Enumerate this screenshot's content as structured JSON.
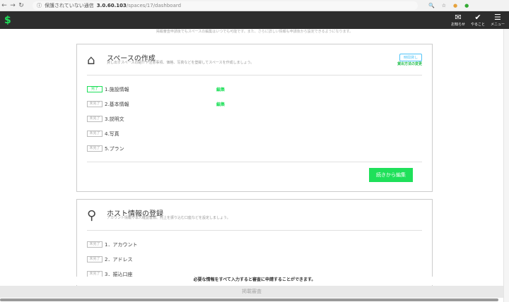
{
  "browser": {
    "insecure": "保護されていない通信",
    "host": "3.0.60.103",
    "path": "/spaces/17/dashboard"
  },
  "header": {
    "logo": "$",
    "buttons": [
      {
        "icon": "✉",
        "label": "お知らせ"
      },
      {
        "icon": "✔",
        "label": "やること"
      },
      {
        "icon": "☰",
        "label": "メニュー"
      }
    ]
  },
  "notice": "掲載審査申請後でもスペースの編集はいつでも可能です。また、さらに詳しい情報も申請後から設定できるようになります。",
  "space": {
    "title": "スペースの作成",
    "desc": "貸し出すスペースの紹介や注意事項、価格、写真などを登録してスペースを作成しましょう。",
    "tag": "時間貸し",
    "change": "貸出方法の変更",
    "edit": "編集",
    "items": [
      {
        "status": "完了",
        "label": "1.施設情報"
      },
      {
        "status": "未完了",
        "label": "2.基本情報"
      },
      {
        "status": "未完了",
        "label": "3.説明文"
      },
      {
        "status": "未完了",
        "label": "4.写真"
      },
      {
        "status": "未完了",
        "label": "5.プラン"
      }
    ],
    "continue": "続きから編集"
  },
  "host": {
    "title": "ホスト情報の登録",
    "desc": "アカウント情報や本人確認書類、売上を振り込む口座などを設定しましょう。",
    "items": [
      {
        "status": "未完了",
        "label": "1．アカウント"
      },
      {
        "status": "未完了",
        "label": "2．アドレス"
      },
      {
        "status": "未完了",
        "label": "3．振込口座"
      }
    ]
  },
  "footer": {
    "message": "必要な情報をすべて入力すると審査に申請することができます。",
    "submit": "掲載審査"
  }
}
